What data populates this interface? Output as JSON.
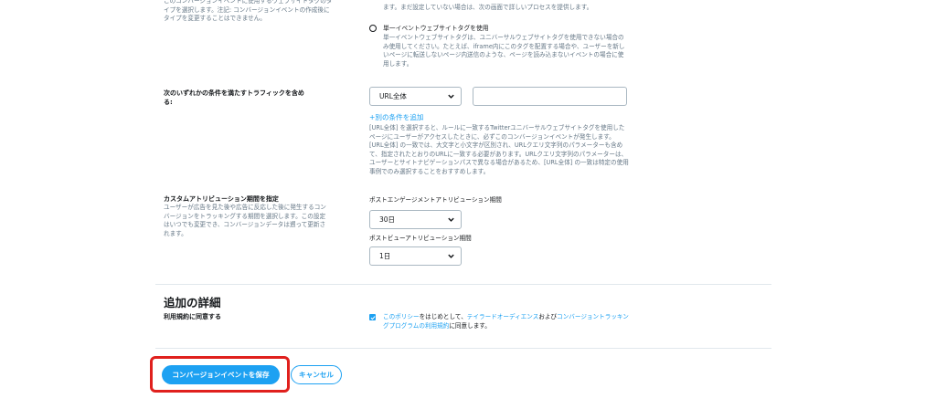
{
  "tag_type": {
    "description": "このコンバージョンイベントに使用するウェブサイトタグのタイプを選択します。注記: コンバージョンイベントの作成後にタイプを変更することはできません。",
    "top_option_text": "ます。まだ設定していない場合は、次の画面で詳しいプロセスを提供します。",
    "single_event_title": "単一イベントウェブサイトタグを使用",
    "single_event_desc": "単一イベントウェブサイトタグは、ユニバーサルウェブサイトタグを使用できない場合のみ使用してください。たとえば、iframe内にこのタグを配置する場合や、ユーザーを新しいページに転送しないページ内送信のような、ページを読み込まないイベントの場合に使用します。"
  },
  "traffic": {
    "label": "次のいずれかの条件を満たすトラフィックを含める:",
    "select_value": "URL全体",
    "url_value": "",
    "add_condition": "+別の条件を追加",
    "help_text": "[URL全体] を選択すると、ルールに一致するTwitterユニバーサルウェブサイトタグを使用したページにユーザーがアクセスしたときに、必ずこのコンバージョンイベントが発生します。[URL全体] の一致では、大文字と小文字が区別され、URLクエリ文字列のパラメーターも含めて、指定されたとおりのURLに一致する必要があります。URLクエリ文字列のパラメーターは、ユーザーとサイトナビゲーションパスで異なる場合があるため、[URL全体] の一致は特定の使用事例でのみ選択することをおすすめします。"
  },
  "attribution": {
    "label": "カスタムアトリビューション期間を指定",
    "description": "ユーザーが広告を見た後や広告に反応した後に発生するコンバージョンをトラッキングする期間を選択します。この設定はいつでも変更でき、コンバージョンデータは遡って更新されます。",
    "engagement_label": "ポストエンゲージメントアトリビューション期間",
    "engagement_value": "30日",
    "view_label": "ポストビューアトリビューション期間",
    "view_value": "1日"
  },
  "details": {
    "heading": "追加の詳細",
    "terms_label": "利用規約に同意する",
    "terms_text_1": "このポリシー",
    "terms_text_2": "をはじめとして、",
    "terms_link_1": "テイラードオーディエンス",
    "terms_text_3": "および",
    "terms_link_2": "コンバージョントラッキングプログラムの利用規約",
    "terms_text_4": "に同意します。",
    "terms_checked": true
  },
  "actions": {
    "save_label": "コンバージョンイベントを保存",
    "cancel_label": "キャンセル"
  },
  "colors": {
    "accent": "#1da1f2",
    "highlight": "#e0201d",
    "muted_text": "#657786",
    "divider": "#e1e8ed"
  }
}
